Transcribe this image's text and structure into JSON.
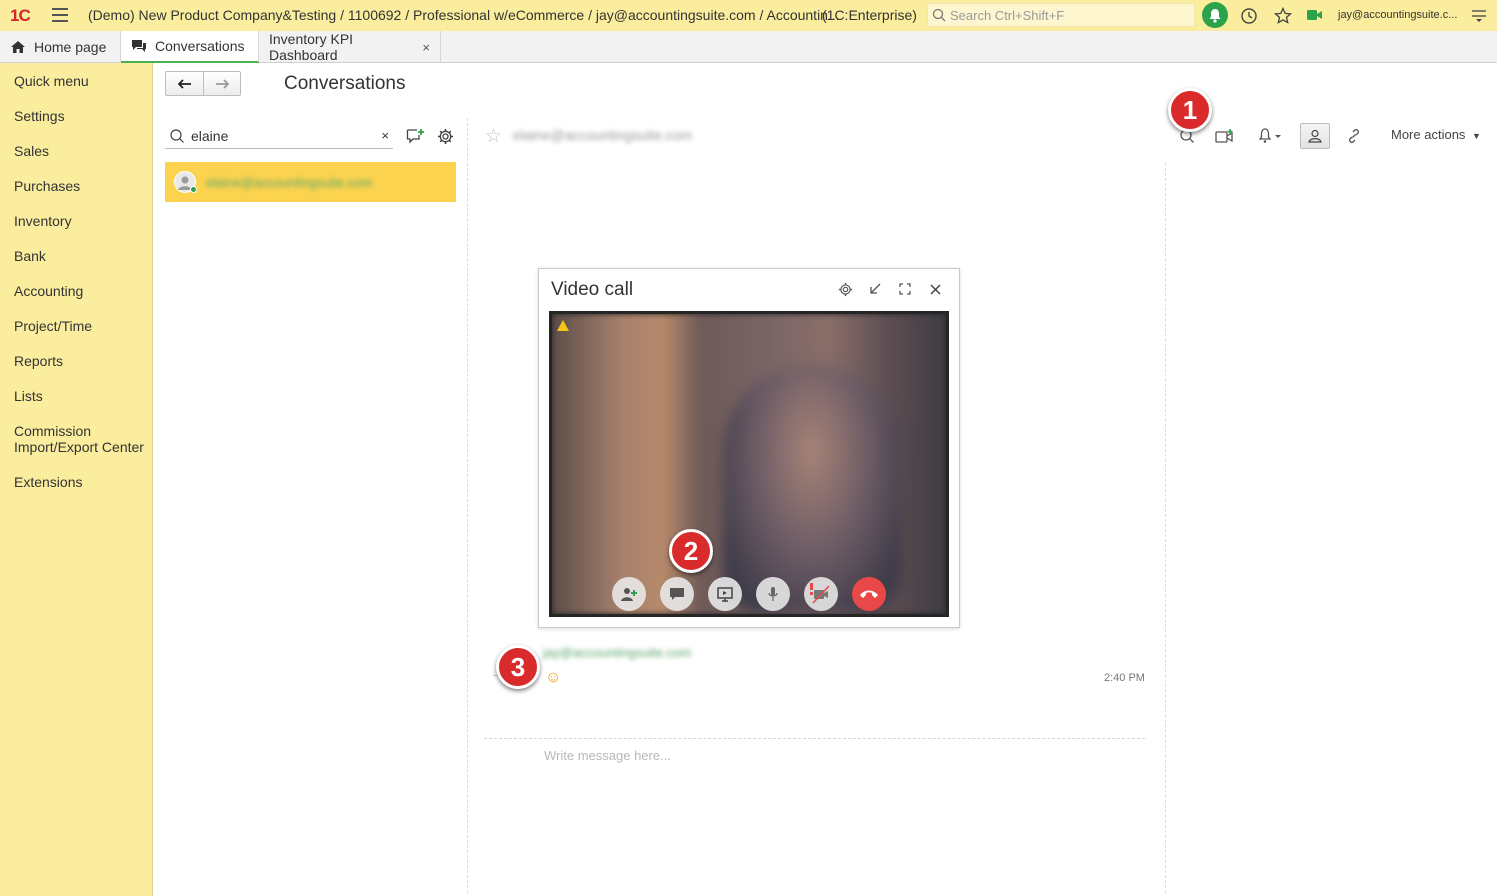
{
  "topbar": {
    "logo": "1C",
    "title": "(Demo) New Product Company&Testing / 1100692 / Professional w/eCommerce / jay@accountingsuite.com / Accountin...",
    "mode": "(1C:Enterprise)",
    "search_placeholder": "Search Ctrl+Shift+F",
    "user": "jay@accountingsuite.c..."
  },
  "tabs": [
    {
      "label": "Home page",
      "icon": "home-icon"
    },
    {
      "label": "Conversations",
      "icon": "conversations-icon"
    },
    {
      "label": "Inventory KPI Dashboard",
      "close": "×"
    }
  ],
  "sidebar": {
    "items": [
      {
        "label": "Quick menu"
      },
      {
        "label": "Settings"
      },
      {
        "label": "Sales"
      },
      {
        "label": "Purchases"
      },
      {
        "label": "Inventory"
      },
      {
        "label": "Bank"
      },
      {
        "label": "Accounting"
      },
      {
        "label": "Project/Time"
      },
      {
        "label": "Reports"
      },
      {
        "label": "Lists"
      },
      {
        "label": "Commission Import/Export Center"
      },
      {
        "label": "Extensions"
      }
    ]
  },
  "main": {
    "title": "Conversations",
    "search": {
      "value": "elaine",
      "clear": "×"
    },
    "conversation_item": {
      "name": "elaine@accountingsuite.com"
    },
    "header": {
      "name": "elaine@accountingsuite.com",
      "more_actions": "More actions"
    }
  },
  "video_call": {
    "title": "Video call"
  },
  "message": {
    "sender": "jay@accountingsuite.com",
    "text": "☺",
    "time": "2:40 PM"
  },
  "compose": {
    "placeholder": "Write message here..."
  },
  "badges": {
    "one": "1",
    "two": "2",
    "three": "3"
  },
  "colors": {
    "sidebar": "#fbed9e",
    "selected_item": "#fbd34f",
    "accent_green": "#2aa34a",
    "badge_red": "#d92b2b"
  }
}
